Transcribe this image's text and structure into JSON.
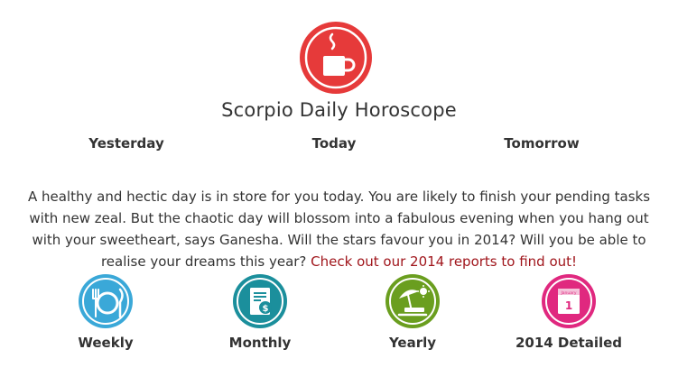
{
  "header": {
    "title": "Scorpio Daily Horoscope",
    "icon": "coffee-cup-icon",
    "icon_color": "#e63a3a"
  },
  "day_tabs": [
    {
      "label": "Yesterday"
    },
    {
      "label": "Today"
    },
    {
      "label": "Tomorrow"
    }
  ],
  "content": {
    "text": "A healthy and hectic day is in store for you today. You are likely to finish your pending tasks with new zeal. But the chaotic day will blossom into a fabulous evening when you hang out with your sweetheart, says Ganesha. Will the stars favour you in 2014? Will you be able to realise your dreams this year? ",
    "link_text": "Check out our 2014 reports to find out!",
    "link_color": "#a0161c"
  },
  "reports": [
    {
      "label": "Weekly",
      "icon": "dining-plate-icon",
      "color": "#3aa8d8"
    },
    {
      "label": "Monthly",
      "icon": "bill-document-icon",
      "color": "#1b8f9c"
    },
    {
      "label": "Yearly",
      "icon": "beach-umbrella-icon",
      "color": "#6a9e1f"
    },
    {
      "label": "2014 Detailed",
      "icon": "calendar-icon",
      "color": "#e0287f"
    }
  ]
}
